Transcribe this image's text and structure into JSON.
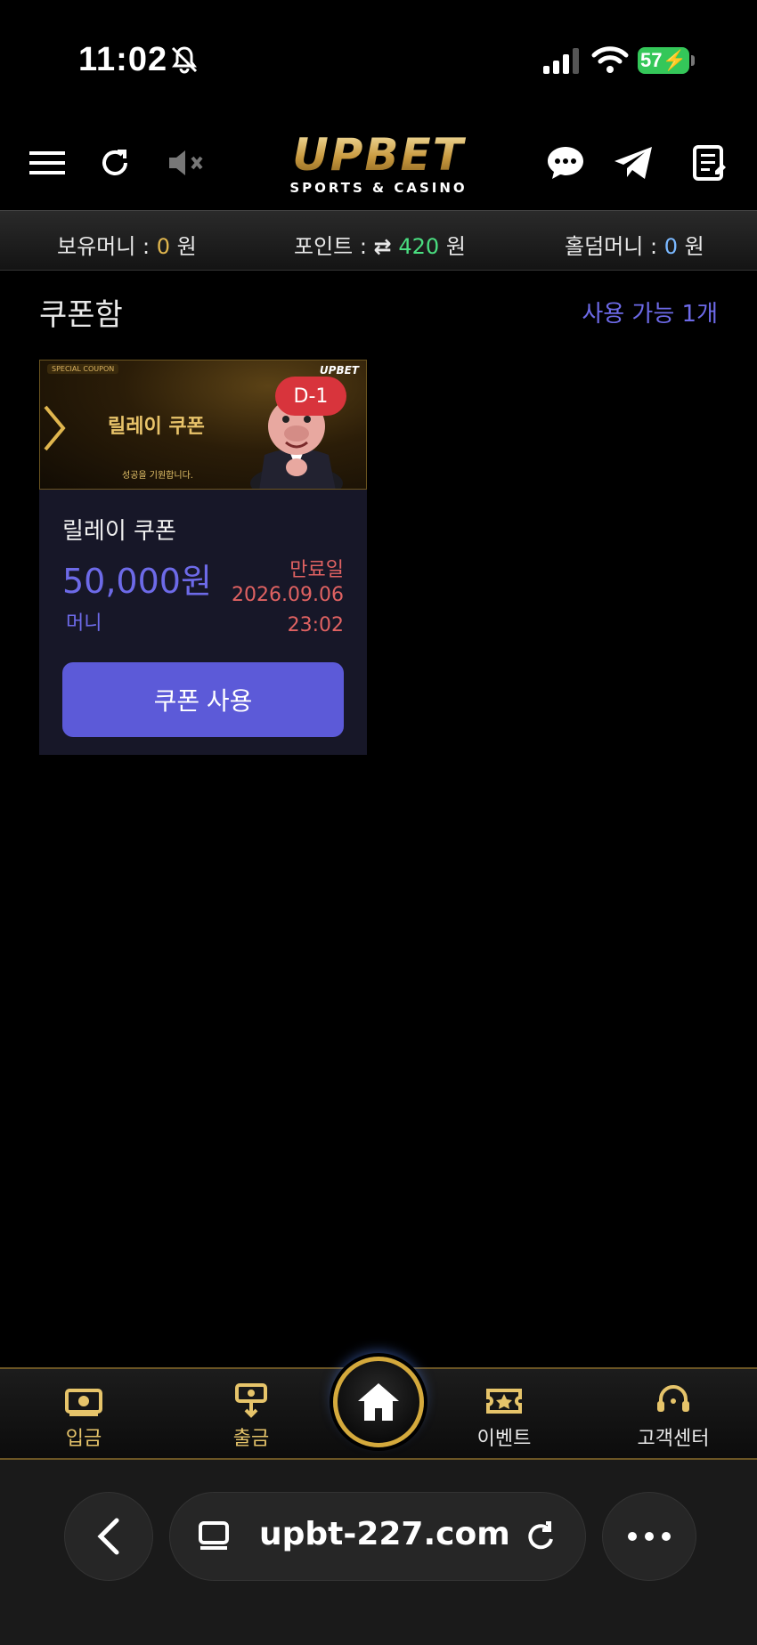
{
  "status_bar": {
    "time": "11:02",
    "battery": "57"
  },
  "header": {
    "logo_main": "UPBET",
    "logo_sub": "SPORTS & CASINO",
    "icons": [
      "menu-icon",
      "refresh-icon",
      "mute-icon",
      "chat-icon",
      "telegram-icon",
      "notes-icon"
    ]
  },
  "balance": {
    "money_label": "보유머니 :",
    "money_value": "0",
    "money_unit": "원",
    "point_label": "포인트 :",
    "point_value": "420",
    "point_unit": "원",
    "holdem_label": "홀덤머니 :",
    "holdem_value": "0",
    "holdem_unit": "원"
  },
  "coupons": {
    "title": "쿠폰함",
    "available": "사용 가능 1개",
    "items": [
      {
        "banner_tag": "SPECIAL COUPON",
        "banner_title": "릴레이 쿠폰",
        "banner_sub": "성공을 기원합니다.",
        "banner_logo": "UPBET",
        "d_day": "D-1",
        "name": "릴레이 쿠폰",
        "amount": "50,000원",
        "type": "머니",
        "expiry_label": "만료일",
        "expiry_date": "2026.09.06",
        "expiry_time": "23:02",
        "button": "쿠폰 사용"
      }
    ]
  },
  "bottom_nav": {
    "items": [
      {
        "label": "입금",
        "icon": "deposit-icon"
      },
      {
        "label": "출금",
        "icon": "withdraw-icon"
      },
      {
        "label": "이벤트",
        "icon": "event-icon"
      },
      {
        "label": "고객센터",
        "icon": "support-icon"
      }
    ],
    "home_icon": "home-icon"
  },
  "browser": {
    "url": "upbt-227.com"
  },
  "colors": {
    "accent": "#5c5ad8",
    "gold": "#c9a24d",
    "danger": "#e06262",
    "point_green": "#4ade80"
  }
}
